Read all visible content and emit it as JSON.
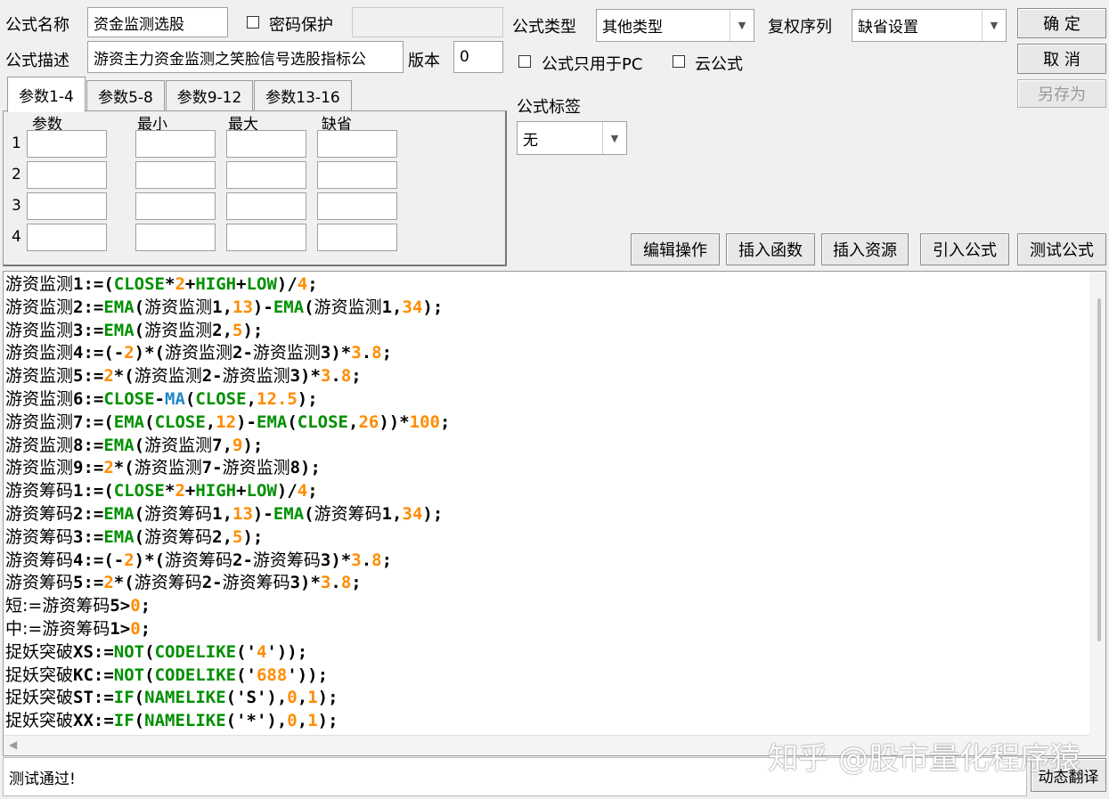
{
  "labels": {
    "formula_name": "公式名称",
    "formula_desc": "公式描述",
    "password": "密码保护",
    "version": "版本",
    "formula_type": "公式类型",
    "rights_seq": "复权序列",
    "pc_only": "公式只用于PC",
    "cloud": "云公式",
    "formula_tag": "公式标签"
  },
  "inputs": {
    "name_value": "资金监测选股",
    "desc_value": "游资主力资金监测之笑脸信号选股指标公",
    "password_value": "",
    "version_value": "0"
  },
  "combos": {
    "type_value": "其他类型",
    "rights_value": "缺省设置",
    "tag_value": "无"
  },
  "buttons": {
    "ok": "确 定",
    "cancel": "取 消",
    "save_as": "另存为",
    "edit_ops": "编辑操作",
    "insert_func": "插入函数",
    "insert_res": "插入资源",
    "import_formula": "引入公式",
    "test_formula": "测试公式",
    "dyn_translate": "动态翻译"
  },
  "tabs": [
    "参数1-4",
    "参数5-8",
    "参数9-12",
    "参数13-16"
  ],
  "param_headers": [
    "参数",
    "最小",
    "最大",
    "缺省"
  ],
  "param_rows": [
    "1",
    "2",
    "3",
    "4"
  ],
  "status_text": "测试通过!",
  "watermark": "知乎 @股市量化程序猿",
  "colors": {
    "keyword_green": "#009000",
    "number_orange": "#ff8c00",
    "ma_blue": "#1e88c8",
    "text_black": "#000000"
  },
  "code_lines": [
    [
      [
        "游资监测",
        "cn"
      ],
      [
        "1:=(",
        ""
      ],
      [
        "CLOSE",
        "g"
      ],
      [
        "*",
        ""
      ],
      [
        "2",
        "o"
      ],
      [
        "+",
        ""
      ],
      [
        "HIGH",
        "g"
      ],
      [
        "+",
        ""
      ],
      [
        "LOW",
        "g"
      ],
      [
        ")/",
        ""
      ],
      [
        "4",
        "o"
      ],
      [
        ";",
        ""
      ]
    ],
    [
      [
        "游资监测",
        "cn"
      ],
      [
        "2:=",
        ""
      ],
      [
        "EMA",
        "g"
      ],
      [
        "(",
        ""
      ],
      [
        "游资监测",
        "cn"
      ],
      [
        "1,",
        ""
      ],
      [
        "13",
        "o"
      ],
      [
        ")-",
        ""
      ],
      [
        "EMA",
        "g"
      ],
      [
        "(",
        ""
      ],
      [
        "游资监测",
        "cn"
      ],
      [
        "1,",
        ""
      ],
      [
        "34",
        "o"
      ],
      [
        ");",
        ""
      ]
    ],
    [
      [
        "游资监测",
        "cn"
      ],
      [
        "3:=",
        ""
      ],
      [
        "EMA",
        "g"
      ],
      [
        "(",
        ""
      ],
      [
        "游资监测",
        "cn"
      ],
      [
        "2,",
        ""
      ],
      [
        "5",
        "o"
      ],
      [
        ");",
        ""
      ]
    ],
    [
      [
        "游资监测",
        "cn"
      ],
      [
        "4:=(-",
        ""
      ],
      [
        "2",
        "o"
      ],
      [
        ")*(",
        ""
      ],
      [
        "游资监测",
        "cn"
      ],
      [
        "2-",
        ""
      ],
      [
        "游资监测",
        "cn"
      ],
      [
        "3)*",
        ""
      ],
      [
        "3",
        "o"
      ],
      [
        ".",
        ""
      ],
      [
        "8",
        "o"
      ],
      [
        ";",
        ""
      ]
    ],
    [
      [
        "游资监测",
        "cn"
      ],
      [
        "5:=",
        ""
      ],
      [
        "2",
        "o"
      ],
      [
        "*(",
        ""
      ],
      [
        "游资监测",
        "cn"
      ],
      [
        "2-",
        ""
      ],
      [
        "游资监测",
        "cn"
      ],
      [
        "3)*",
        ""
      ],
      [
        "3",
        "o"
      ],
      [
        ".",
        ""
      ],
      [
        "8",
        "o"
      ],
      [
        ";",
        ""
      ]
    ],
    [
      [
        "游资监测",
        "cn"
      ],
      [
        "6:=",
        ""
      ],
      [
        "CLOSE",
        "g"
      ],
      [
        "-",
        ""
      ],
      [
        "MA",
        "b"
      ],
      [
        "(",
        ""
      ],
      [
        "CLOSE",
        "g"
      ],
      [
        ",",
        ""
      ],
      [
        "12.5",
        "o"
      ],
      [
        ");",
        ""
      ]
    ],
    [
      [
        "游资监测",
        "cn"
      ],
      [
        "7:=(",
        ""
      ],
      [
        "EMA",
        "g"
      ],
      [
        "(",
        ""
      ],
      [
        "CLOSE",
        "g"
      ],
      [
        ",",
        ""
      ],
      [
        "12",
        "o"
      ],
      [
        ")-",
        ""
      ],
      [
        "EMA",
        "g"
      ],
      [
        "(",
        ""
      ],
      [
        "CLOSE",
        "g"
      ],
      [
        ",",
        ""
      ],
      [
        "26",
        "o"
      ],
      [
        "))*",
        ""
      ],
      [
        "100",
        "o"
      ],
      [
        ";",
        ""
      ]
    ],
    [
      [
        "游资监测",
        "cn"
      ],
      [
        "8:=",
        ""
      ],
      [
        "EMA",
        "g"
      ],
      [
        "(",
        ""
      ],
      [
        "游资监测",
        "cn"
      ],
      [
        "7,",
        ""
      ],
      [
        "9",
        "o"
      ],
      [
        ");",
        ""
      ]
    ],
    [
      [
        "游资监测",
        "cn"
      ],
      [
        "9:=",
        ""
      ],
      [
        "2",
        "o"
      ],
      [
        "*(",
        ""
      ],
      [
        "游资监测",
        "cn"
      ],
      [
        "7-",
        ""
      ],
      [
        "游资监测",
        "cn"
      ],
      [
        "8);",
        ""
      ]
    ],
    [
      [
        "游资筹码",
        "cn"
      ],
      [
        "1:=(",
        ""
      ],
      [
        "CLOSE",
        "g"
      ],
      [
        "*",
        ""
      ],
      [
        "2",
        "o"
      ],
      [
        "+",
        ""
      ],
      [
        "HIGH",
        "g"
      ],
      [
        "+",
        ""
      ],
      [
        "LOW",
        "g"
      ],
      [
        ")/",
        ""
      ],
      [
        "4",
        "o"
      ],
      [
        ";",
        ""
      ]
    ],
    [
      [
        "游资筹码",
        "cn"
      ],
      [
        "2:=",
        ""
      ],
      [
        "EMA",
        "g"
      ],
      [
        "(",
        ""
      ],
      [
        "游资筹码",
        "cn"
      ],
      [
        "1,",
        ""
      ],
      [
        "13",
        "o"
      ],
      [
        ")-",
        ""
      ],
      [
        "EMA",
        "g"
      ],
      [
        "(",
        ""
      ],
      [
        "游资筹码",
        "cn"
      ],
      [
        "1,",
        ""
      ],
      [
        "34",
        "o"
      ],
      [
        ");",
        ""
      ]
    ],
    [
      [
        "游资筹码",
        "cn"
      ],
      [
        "3:=",
        ""
      ],
      [
        "EMA",
        "g"
      ],
      [
        "(",
        ""
      ],
      [
        "游资筹码",
        "cn"
      ],
      [
        "2,",
        ""
      ],
      [
        "5",
        "o"
      ],
      [
        ");",
        ""
      ]
    ],
    [
      [
        "游资筹码",
        "cn"
      ],
      [
        "4:=(-",
        ""
      ],
      [
        "2",
        "o"
      ],
      [
        ")*(",
        ""
      ],
      [
        "游资筹码",
        "cn"
      ],
      [
        "2-",
        ""
      ],
      [
        "游资筹码",
        "cn"
      ],
      [
        "3)*",
        ""
      ],
      [
        "3",
        "o"
      ],
      [
        ".",
        ""
      ],
      [
        "8",
        "o"
      ],
      [
        ";",
        ""
      ]
    ],
    [
      [
        "游资筹码",
        "cn"
      ],
      [
        "5:=",
        ""
      ],
      [
        "2",
        "o"
      ],
      [
        "*(",
        ""
      ],
      [
        "游资筹码",
        "cn"
      ],
      [
        "2-",
        ""
      ],
      [
        "游资筹码",
        "cn"
      ],
      [
        "3)*",
        ""
      ],
      [
        "3",
        "o"
      ],
      [
        ".",
        ""
      ],
      [
        "8",
        "o"
      ],
      [
        ";",
        ""
      ]
    ],
    [
      [
        "短:=游资筹码",
        "cn"
      ],
      [
        "5>",
        ""
      ],
      [
        "0",
        "o"
      ],
      [
        ";",
        ""
      ]
    ],
    [
      [
        "中:=游资筹码",
        "cn"
      ],
      [
        "1>",
        ""
      ],
      [
        "0",
        "o"
      ],
      [
        ";",
        ""
      ]
    ],
    [
      [
        "捉妖突破",
        "cn"
      ],
      [
        "XS:=",
        ""
      ],
      [
        "NOT",
        "g"
      ],
      [
        "(",
        ""
      ],
      [
        "CODELIKE",
        "g"
      ],
      [
        "('",
        ""
      ],
      [
        "4",
        "o"
      ],
      [
        "'));",
        ""
      ]
    ],
    [
      [
        "捉妖突破",
        "cn"
      ],
      [
        "KC:=",
        ""
      ],
      [
        "NOT",
        "g"
      ],
      [
        "(",
        ""
      ],
      [
        "CODELIKE",
        "g"
      ],
      [
        "('",
        ""
      ],
      [
        "688",
        "o"
      ],
      [
        "'));",
        ""
      ]
    ],
    [
      [
        "捉妖突破",
        "cn"
      ],
      [
        "ST:=",
        ""
      ],
      [
        "IF",
        "g"
      ],
      [
        "(",
        ""
      ],
      [
        "NAMELIKE",
        "g"
      ],
      [
        "('S'),",
        ""
      ],
      [
        "0",
        "o"
      ],
      [
        ",",
        ""
      ],
      [
        "1",
        "o"
      ],
      [
        ");",
        ""
      ]
    ],
    [
      [
        "捉妖突破",
        "cn"
      ],
      [
        "XX:=",
        ""
      ],
      [
        "IF",
        "g"
      ],
      [
        "(",
        ""
      ],
      [
        "NAMELIKE",
        "g"
      ],
      [
        "('*'),",
        ""
      ],
      [
        "0",
        "o"
      ],
      [
        ",",
        ""
      ],
      [
        "1",
        "o"
      ],
      [
        ");",
        ""
      ]
    ]
  ]
}
